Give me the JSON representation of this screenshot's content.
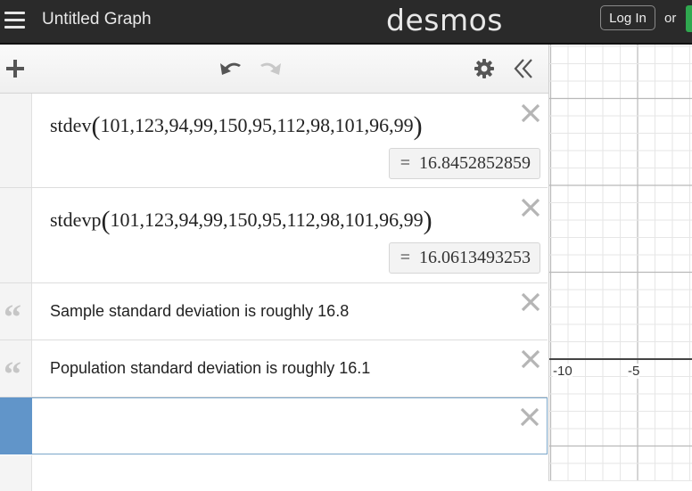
{
  "header": {
    "title": "Untitled Graph",
    "logo": "desmos",
    "login_label": "Log In",
    "or_label": "or",
    "signup_color": "#2fa84f"
  },
  "toolbar": {
    "icons": [
      "plus-icon",
      "undo-icon",
      "redo-icon",
      "gear-icon",
      "double-chevron-left-icon"
    ]
  },
  "expressions": [
    {
      "type": "math",
      "func": "stdev",
      "args": "101,123,94,99,150,95,112,98,101,96,99",
      "result_eq": "=",
      "result": "16.8452852859"
    },
    {
      "type": "math",
      "func": "stdevp",
      "args": "101,123,94,99,150,95,112,98,101,96,99",
      "result_eq": "=",
      "result": "16.0613493253"
    },
    {
      "type": "note",
      "text": "Sample standard deviation is roughly 16.8"
    },
    {
      "type": "note",
      "text": "Population standard deviation is roughly 16.1"
    },
    {
      "type": "empty",
      "text": ""
    }
  ],
  "graph": {
    "x_tick_labels": [
      "-10",
      "-5"
    ],
    "accent_color": "#6195c9"
  }
}
